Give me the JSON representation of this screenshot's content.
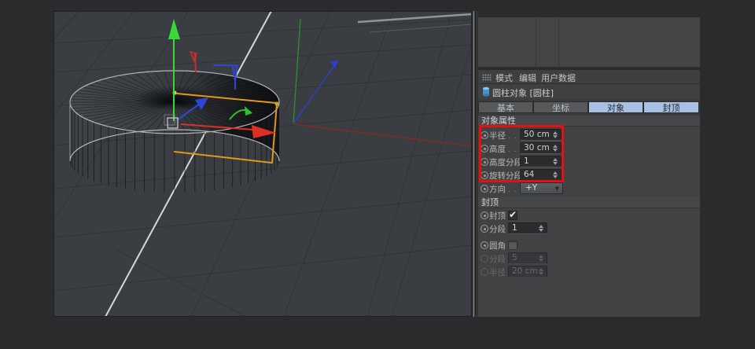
{
  "colors": {
    "highlight_red": "#e51010",
    "tab_selected_blue": "#a8c1e2",
    "handle_orange": "#e2971c",
    "axis_x_red": "#dd3024",
    "axis_y_green": "#3ad23a",
    "axis_z_blue": "#2c46d8",
    "viewport_bg": "#3a3e42",
    "panel_bg": "#414244"
  },
  "attribute_manager": {
    "menu": {
      "items": [
        {
          "label": "模式"
        },
        {
          "label": "编辑"
        },
        {
          "label": "用户数据"
        }
      ]
    },
    "object_header": {
      "title": "圆柱对象 [圆柱]",
      "icon": "cylinder-icon"
    },
    "tabs": [
      {
        "label": "基本",
        "selected": false
      },
      {
        "label": "坐标",
        "selected": false
      },
      {
        "label": "对象",
        "selected": true
      },
      {
        "label": "封顶",
        "selected": true
      }
    ],
    "sections": [
      {
        "title": "对象属性",
        "rows": [
          {
            "label": "半径",
            "ellipsis": ". . .",
            "value": "50 cm",
            "control": "spinner",
            "highlighted": true
          },
          {
            "label": "高度",
            "ellipsis": ". . .",
            "value": "30 cm",
            "control": "spinner",
            "highlighted": true
          },
          {
            "label": "高度分段",
            "value": "1",
            "control": "spinner",
            "highlighted": true
          },
          {
            "label": "旋转分段",
            "value": "64",
            "control": "spinner",
            "highlighted": true
          },
          {
            "label": "方向",
            "ellipsis": ". . .",
            "value": "+Y",
            "control": "dropdown"
          }
        ]
      },
      {
        "title": "封顶",
        "rows": [
          {
            "label": "封顶",
            "control": "checkbox",
            "checked": true
          },
          {
            "label": "分段",
            "value": "1",
            "control": "spinner"
          },
          {
            "label": "圆角",
            "control": "checkbox",
            "checked": false
          },
          {
            "label": "分段",
            "value": "5",
            "control": "spinner",
            "disabled": true
          },
          {
            "label": "半径",
            "value": "20 cm",
            "control": "spinner",
            "disabled": true
          }
        ]
      }
    ],
    "icons": {
      "check": "✔",
      "dropdown_arrow": "▼"
    }
  }
}
